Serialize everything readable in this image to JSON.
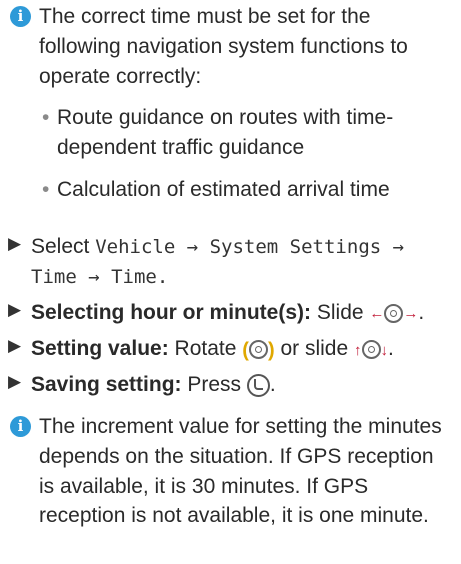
{
  "note1": {
    "icon": "info-icon",
    "intro": "The correct time must be set for the following navigation system functions to operate correctly:",
    "bullets": [
      "Route guidance on routes with time-dependent traffic guidance",
      "Calculation of estimated arrival time"
    ]
  },
  "steps": {
    "select": {
      "prefix": "Select",
      "path": "Vehicle → System Settings → Time → Time."
    },
    "hour_minute": {
      "label": "Selecting hour or minute(s):",
      "action": "Slide",
      "left_arrow": "←",
      "right_arrow": "→"
    },
    "value": {
      "label": "Setting value:",
      "action_rotate": "Rotate",
      "or": "or slide",
      "up_arrow": "↑",
      "down_arrow": "↓"
    },
    "save": {
      "label": "Saving setting:",
      "action": "Press"
    }
  },
  "note2": {
    "icon": "info-icon",
    "text": "The increment value for setting the minutes depends on the situation. If GPS reception is available, it is 30 minutes. If GPS reception is not available, it is one minute."
  },
  "colors": {
    "info_icon": "#2e9ad8",
    "step_arrow": "#333333",
    "rotate_mark": "#e0a800",
    "slide_arrow": "#c21f3a"
  }
}
